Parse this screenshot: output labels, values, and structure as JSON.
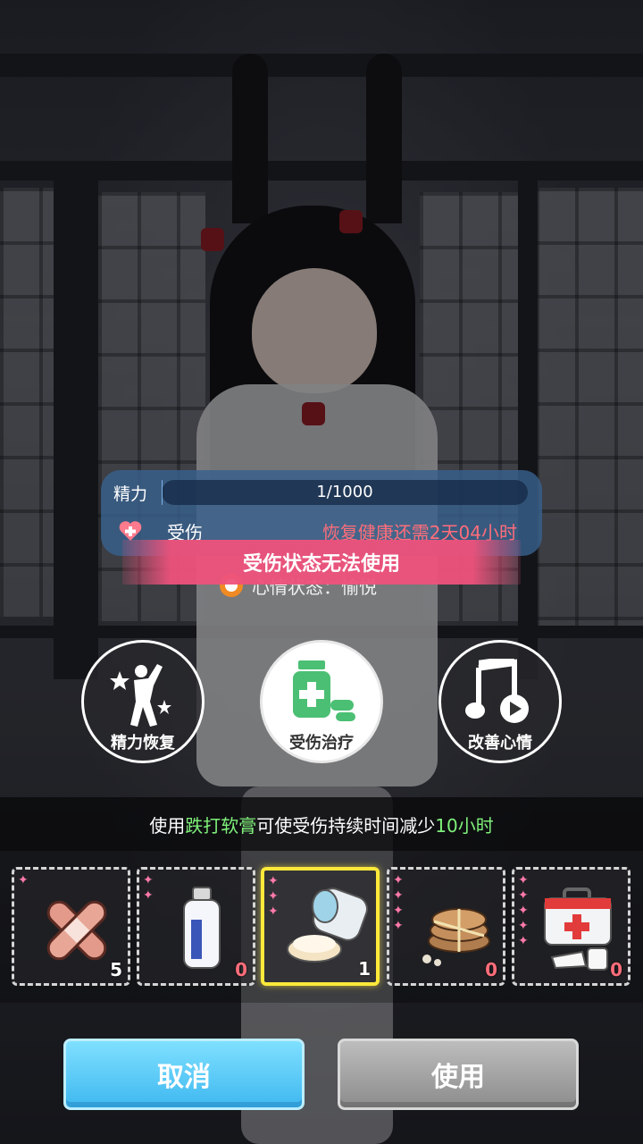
{
  "status": {
    "stamina_label": "精力",
    "stamina_value": "1/1000",
    "stamina_fraction": 0.001,
    "injury_label": "受伤",
    "recovery_text": "恢复健康还需2天04小时",
    "mood_text": "心情状态：愉悦",
    "warning_text": "受伤状态无法使用"
  },
  "actions": [
    {
      "label": "精力恢复",
      "icon": "stamina-recover-icon"
    },
    {
      "label": "受伤治疗",
      "icon": "medicine-bottle-icon"
    },
    {
      "label": "改善心情",
      "icon": "music-note-icon"
    }
  ],
  "hint": {
    "prefix": "使用",
    "item_name": "跌打软膏",
    "middle": "可使受伤持续时间减少",
    "amount": "10小时"
  },
  "items": [
    {
      "name": "bandage",
      "stars": 1,
      "count": "5",
      "selected": false
    },
    {
      "name": "lotion-bottle",
      "stars": 2,
      "count": "0",
      "selected": false
    },
    {
      "name": "ointment-jar",
      "stars": 3,
      "count": "1",
      "selected": true
    },
    {
      "name": "herbal-cake",
      "stars": 4,
      "count": "0",
      "selected": false
    },
    {
      "name": "first-aid-kit",
      "stars": 5,
      "count": "0",
      "selected": false
    }
  ],
  "buttons": {
    "cancel": "取消",
    "use": "使用"
  },
  "colors": {
    "accent_cyan": "#3fb8f0",
    "warning_pink": "#ee527c",
    "hint_green": "#7ff07a",
    "selected_border": "#ffe93a",
    "star_pink": "#ff7aa8"
  }
}
